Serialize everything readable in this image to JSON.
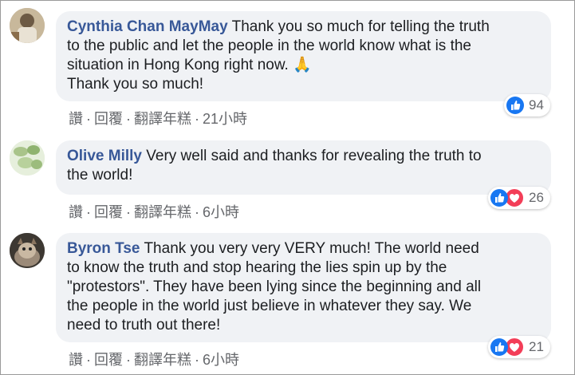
{
  "comments": [
    {
      "author": "Cynthia Chan MayMay",
      "lines": [
        " Thank you so much for telling the truth",
        "to the public and let the people in the world know what is the",
        "situation in Hong Kong right now. 🙏",
        "Thank you so much!"
      ],
      "actions": {
        "like": "讚",
        "reply": "回覆",
        "translate": "翻譯年糕",
        "time": "21小時"
      },
      "reaction_count": "94"
    },
    {
      "author": "Olive Milly",
      "lines": [
        " Very well said and thanks for revealing the truth to",
        "the world!"
      ],
      "actions": {
        "like": "讚",
        "reply": "回覆",
        "translate": "翻譯年糕",
        "time": "6小時"
      },
      "reaction_count": "26"
    },
    {
      "author": "Byron Tse",
      "lines": [
        " Thank you very very VERY much! The world need",
        "to know the truth and stop hearing the lies spin up by the",
        "\"protestors\". They have been lying since the beginning and all",
        "the people in the world just believe in whatever they say. We",
        "need to truth out there!"
      ],
      "actions": {
        "like": "讚",
        "reply": "回覆",
        "translate": "翻譯年糕",
        "time": "6小時"
      },
      "reaction_count": "21"
    }
  ],
  "separator": "·",
  "colors": {
    "author": "#385898",
    "bubble": "#f0f2f5",
    "like": "#1877f2",
    "love": "#f33e58",
    "meta": "#65676b"
  },
  "icons": [
    "like-reaction-icon",
    "love-reaction-icon"
  ]
}
